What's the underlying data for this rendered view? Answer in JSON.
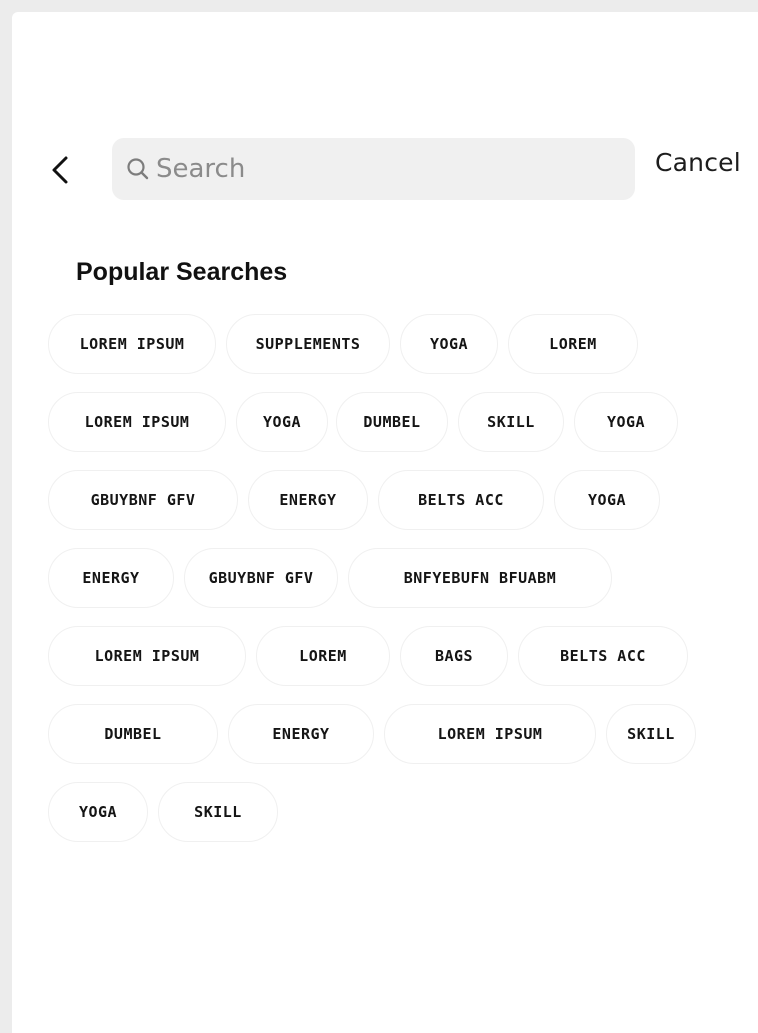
{
  "search": {
    "placeholder": "Search",
    "value": "",
    "cancel_label": "Cancel"
  },
  "popular": {
    "title": "Popular Searches",
    "rows": [
      [
        "LOREM IPSUM",
        "SUPPLEMENTS",
        "YOGA",
        "LOREM"
      ],
      [
        "LOREM IPSUM",
        "YOGA",
        "DUMBEL",
        "SKILL",
        "YOGA"
      ],
      [
        "GBUYBNF GFV",
        "ENERGY",
        "BELTS ACC",
        "YOGA"
      ],
      [
        "ENERGY",
        "GBUYBNF GFV",
        "BNFYEBUFN BFUABM"
      ],
      [
        "LOREM IPSUM",
        "LOREM",
        "BAGS",
        "BELTS ACC"
      ],
      [
        "DUMBEL",
        "ENERGY",
        "LOREM IPSUM",
        "SKILL"
      ],
      [
        "YOGA",
        "SKILL"
      ]
    ]
  },
  "icons": {
    "back": "chevron-left-icon",
    "search": "magnifier-icon"
  },
  "colors": {
    "background": "#ececec",
    "screen": "#ffffff",
    "search_field": "#f0f0f0",
    "chip_border": "#f0f0f0",
    "text": "#151515"
  }
}
